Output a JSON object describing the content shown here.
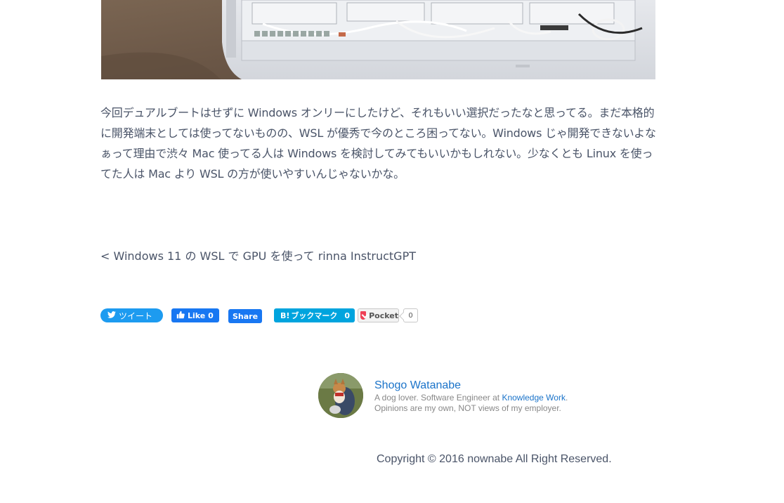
{
  "article": {
    "paragraph": "今回デュアルブートはせずに Windows オンリーにしたけど、それもいい選択だったなと思ってる。まだ本格的に開発端末としては使ってないものの、WSL が優秀で今のところ困ってない。Windows じゃ開発できないよなぁって理由で渋々 Mac 使ってる人は Windows を検討してみてもいいかもしれない。少なくとも Linux を使ってた人は Mac より WSL の方が使いやすいんじゃないかな。"
  },
  "navigation": {
    "prev_link": "< Windows 11 の WSL で GPU を使って rinna InstructGPT"
  },
  "share": {
    "tweet_label": "ツイート",
    "fb_like_label": "Like 0",
    "fb_share_label": "Share",
    "hatena_label": "ブックマーク",
    "hatena_count": "0",
    "pocket_label": "Pocket",
    "pocket_count": "0",
    "colors": {
      "twitter": "#1d9bf0",
      "facebook": "#1877f2",
      "hatena": "#00a4de",
      "pocket": "#ef4056"
    }
  },
  "author": {
    "name": "Shogo Watanabe",
    "bio_line1_prefix": "A dog lover. Software Engineer at ",
    "employer": "Knowledge Work",
    "bio_line1_suffix": ".",
    "bio_line2": "Opinions are my own, NOT views of my employer."
  },
  "footer": {
    "copyright": "Copyright © 2016 nownabe All Right Reserved."
  }
}
